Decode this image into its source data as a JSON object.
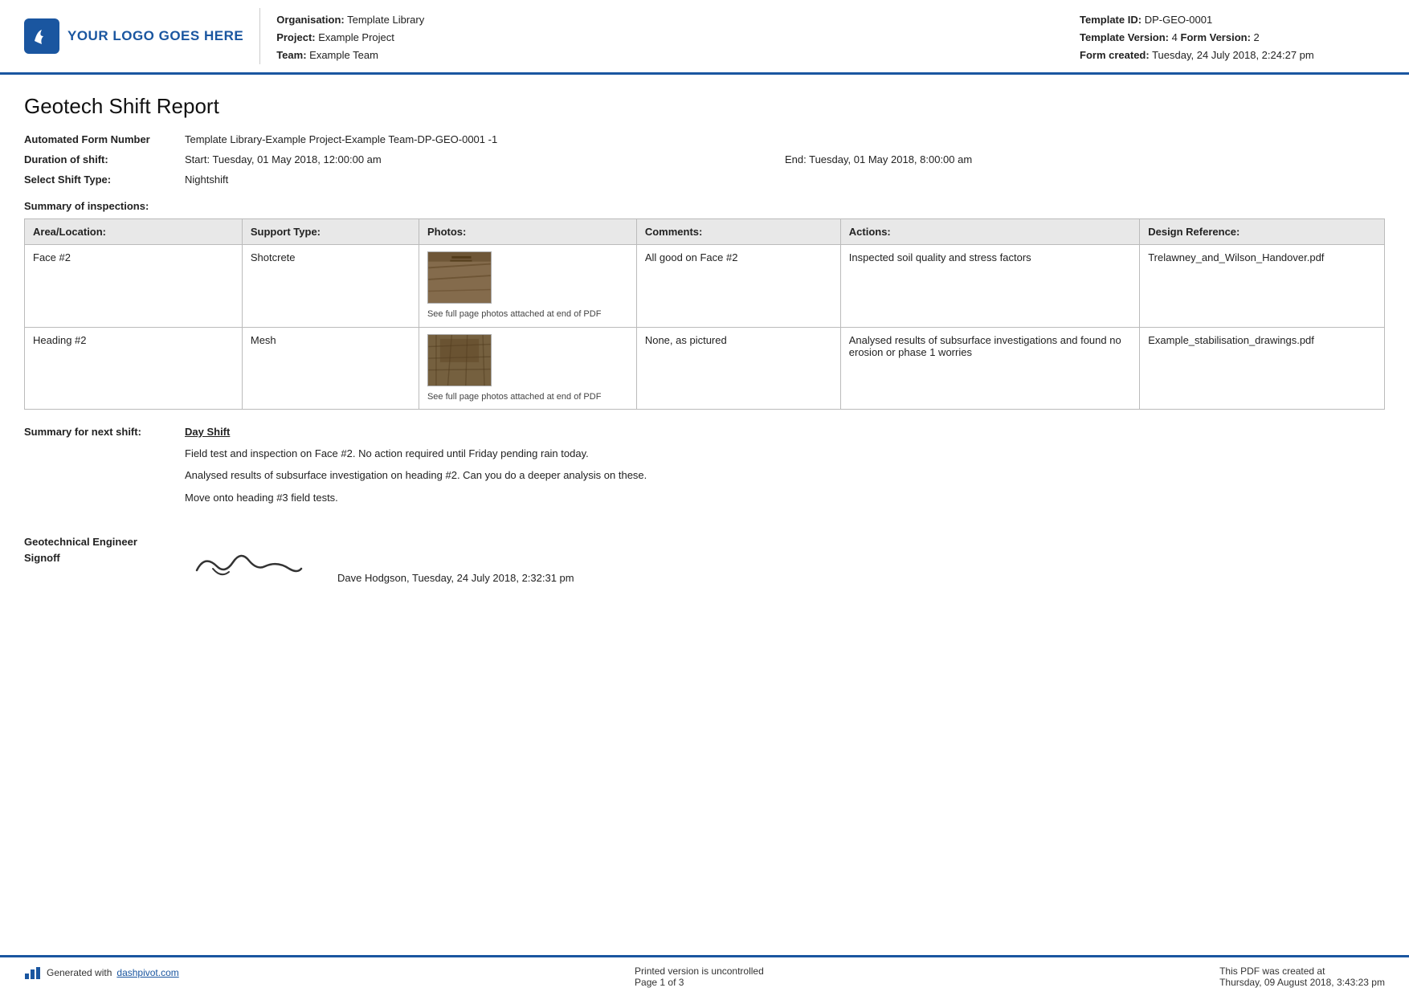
{
  "header": {
    "logo_text": "YOUR LOGO GOES HERE",
    "organisation_label": "Organisation:",
    "organisation_value": "Template Library",
    "project_label": "Project:",
    "project_value": "Example Project",
    "team_label": "Team:",
    "team_value": "Example Team",
    "template_id_label": "Template ID:",
    "template_id_value": "DP-GEO-0001",
    "template_version_label": "Template Version:",
    "template_version_value": "4",
    "form_version_label": "Form Version:",
    "form_version_value": "2",
    "form_created_label": "Form created:",
    "form_created_value": "Tuesday, 24 July 2018, 2:24:27 pm"
  },
  "report": {
    "title": "Geotech Shift Report",
    "automated_form_label": "Automated Form Number",
    "automated_form_value": "Template Library-Example Project-Example Team-DP-GEO-0001   -1",
    "duration_label": "Duration of shift:",
    "duration_start": "Start: Tuesday, 01 May 2018, 12:00:00 am",
    "duration_end": "End: Tuesday, 01 May 2018, 8:00:00 am",
    "shift_type_label": "Select Shift Type:",
    "shift_type_value": "Nightshift",
    "summary_heading": "Summary of inspections:"
  },
  "table": {
    "headers": [
      "Area/Location:",
      "Support Type:",
      "Photos:",
      "Comments:",
      "Actions:",
      "Design Reference:"
    ],
    "rows": [
      {
        "area": "Face #2",
        "support": "Shotcrete",
        "photo_caption": "See full page photos attached at end of PDF",
        "comments": "All good on Face #2",
        "actions": "Inspected soil quality and stress factors",
        "design_ref": "Trelawney_and_Wilson_Handover.pdf"
      },
      {
        "area": "Heading #2",
        "support": "Mesh",
        "photo_caption": "See full page photos attached at end of PDF",
        "comments": "None, as pictured",
        "actions": "Analysed results of subsurface investigations and found no erosion or phase 1 worries",
        "design_ref": "Example_stabilisation_drawings.pdf"
      }
    ]
  },
  "next_shift": {
    "label": "Summary for next shift:",
    "title": "Day Shift",
    "paragraphs": [
      "Field test and inspection on Face #2. No action required until Friday pending rain today.",
      "Analysed results of subsurface investigation on heading #2. Can you do a deeper analysis on these.",
      "Move onto heading #3 field tests."
    ]
  },
  "signoff": {
    "label_line1": "Geotechnical Engineer",
    "label_line2": "Signoff",
    "name_date": "Dave Hodgson, Tuesday, 24 July 2018, 2:32:31 pm"
  },
  "footer": {
    "generated_text": "Generated with ",
    "generated_link": "dashpivot.com",
    "center_text": "Printed version is uncontrolled",
    "page_text": "Page 1 of 3",
    "right_text": "This PDF was created at",
    "right_date": "Thursday, 09 August 2018, 3:43:23 pm"
  }
}
